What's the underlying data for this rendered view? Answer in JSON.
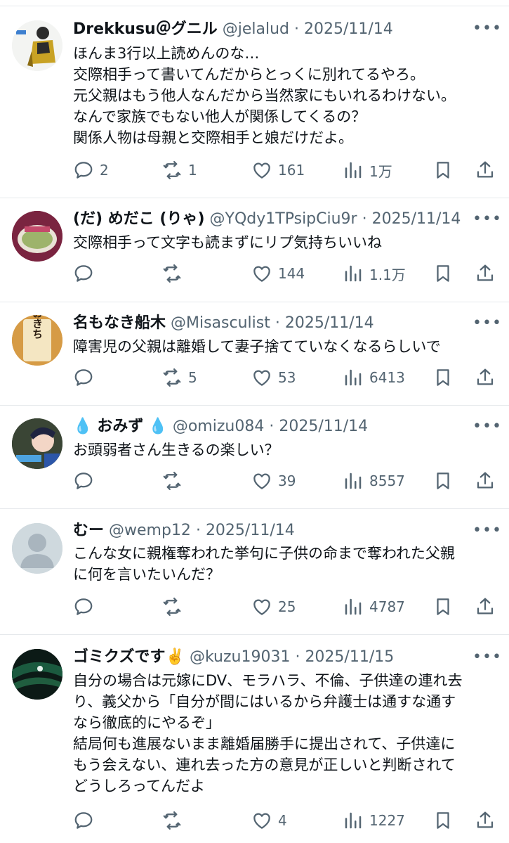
{
  "tweets": [
    {
      "name": "Drekkusu＠グニル",
      "handle": "@jelalud",
      "separator": "·",
      "date": "2025/11/14",
      "lines": [
        "ほんま3行以上読めんのな…",
        "交際相手って書いてんだからとっくに別れてるやろ。",
        "元父親はもう他人なんだから当然家にもいれるわけない。",
        "なんで家族でもない他人が関係してくるの？",
        "関係人物は母親と交際相手と娘だけだよ。"
      ],
      "stats": {
        "replies": "2",
        "reposts": "1",
        "likes": "161",
        "views": "1万"
      },
      "more_label": "•••"
    },
    {
      "name": "(だ) めだこ (りゃ)",
      "handle": "@YQdy1TPsipCiu9r",
      "separator": "·",
      "date": "2025/11/14",
      "lines": [
        "交際相手って文字も読まずにリプ気持ちいいね"
      ],
      "stats": {
        "replies": "",
        "reposts": "",
        "likes": "144",
        "views": "1.1万"
      },
      "more_label": "•••"
    },
    {
      "name": "名もなき船木",
      "handle": "@Misasculist",
      "separator": "·",
      "date": "2025/11/14",
      "lines": [
        "障害児の父親は離婚して妻子捨てていなくなるらしいで"
      ],
      "stats": {
        "replies": "",
        "reposts": "5",
        "likes": "53",
        "views": "6413"
      },
      "more_label": "•••",
      "avatar_text": "おきち"
    },
    {
      "name_prefix": "💧",
      "name": "おみず",
      "name_suffix": "💧",
      "handle": "@omizu084",
      "separator": "·",
      "date": "2025/11/14",
      "lines": [
        "お頭弱者さん生きるの楽しい？"
      ],
      "stats": {
        "replies": "",
        "reposts": "",
        "likes": "39",
        "views": "8557"
      },
      "more_label": "•••"
    },
    {
      "name": "むー",
      "handle": "@wemp12",
      "separator": "·",
      "date": "2025/11/14",
      "lines": [
        "こんな女に親権奪われた挙句に子供の命まで奪われた父親",
        "に何を言いたいんだ？"
      ],
      "stats": {
        "replies": "",
        "reposts": "",
        "likes": "25",
        "views": "4787"
      },
      "more_label": "•••"
    },
    {
      "name": "ゴミクズです✌️",
      "handle": "@kuzu19031",
      "separator": "·",
      "date": "2025/11/15",
      "lines": [
        "自分の場合は元嫁にDV、モラハラ、不倫、子供達の連れ去",
        "り、義父から「自分が間にはいるから弁護士は通すな通す",
        "なら徹底的にやるぞ」",
        "結局何も進展ないまま離婚届勝手に提出されて、子供達に",
        "もう会えない、連れ去った方の意見が正しいと判断されて",
        "どうしろってんだよ"
      ],
      "stats": {
        "replies": "",
        "reposts": "",
        "likes": "4",
        "views": "1227"
      },
      "more_label": "•••"
    }
  ],
  "colors": {
    "text": "#0f1419",
    "secondary": "#536471",
    "divider": "#e6e9ec",
    "default_avatar_bg": "#cfd9de",
    "default_avatar_fg": "#a9b5be"
  },
  "icons": [
    "reply-icon",
    "repost-icon",
    "like-icon",
    "views-icon",
    "bookmark-icon",
    "share-icon",
    "more-icon"
  ]
}
